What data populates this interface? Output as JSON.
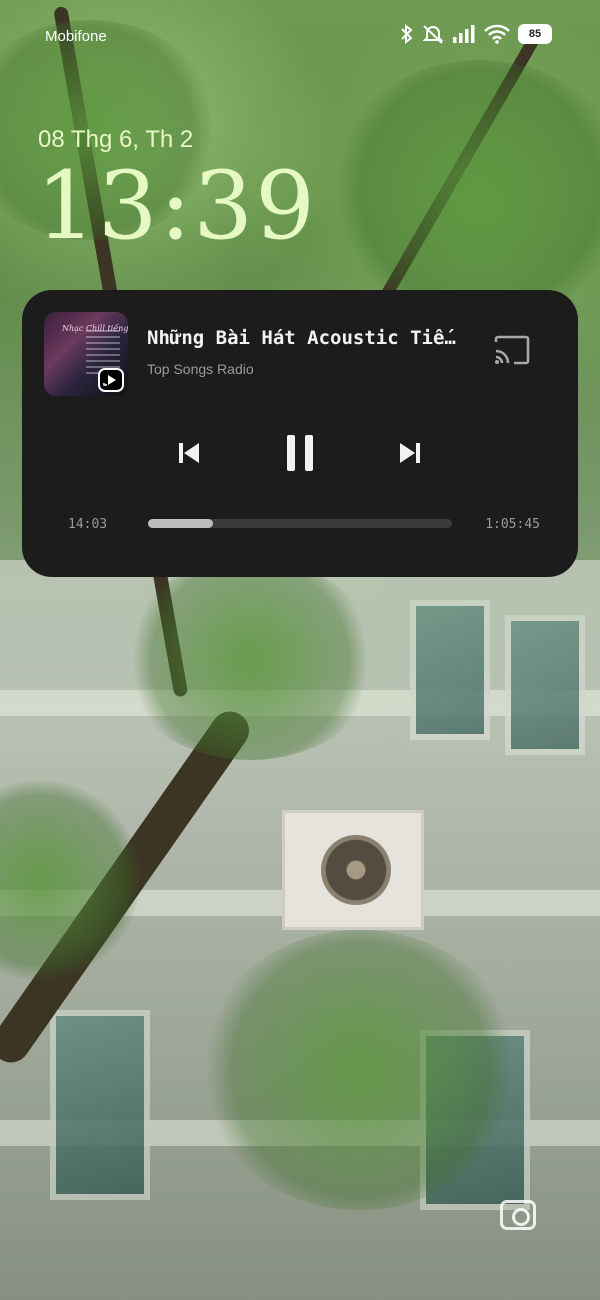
{
  "status_bar": {
    "carrier": "Mobifone",
    "icons": [
      "bluetooth-icon",
      "mute-icon",
      "signal-icon",
      "wifi-icon",
      "battery-icon"
    ],
    "battery_level": "85"
  },
  "lockscreen": {
    "date": "08 Thg 6, Th 2",
    "time": "13:39",
    "clock_color": "#e6f8c4"
  },
  "media_player": {
    "album_art_text": "Nhạc Chill tiếng",
    "track_title": "Những Bài Hát Acoustic Tiếng Việt",
    "subtitle": "Top Songs Radio",
    "elapsed": "14:03",
    "duration": "1:05:45",
    "progress_fraction": 0.2136,
    "icons": [
      "cast-icon",
      "skip-previous-icon",
      "pause-icon",
      "skip-next-icon"
    ],
    "card_color": "#1c1c1c",
    "accent_color": "#bdbdbd"
  },
  "shortcuts": {
    "camera_icon": "camera-icon"
  }
}
